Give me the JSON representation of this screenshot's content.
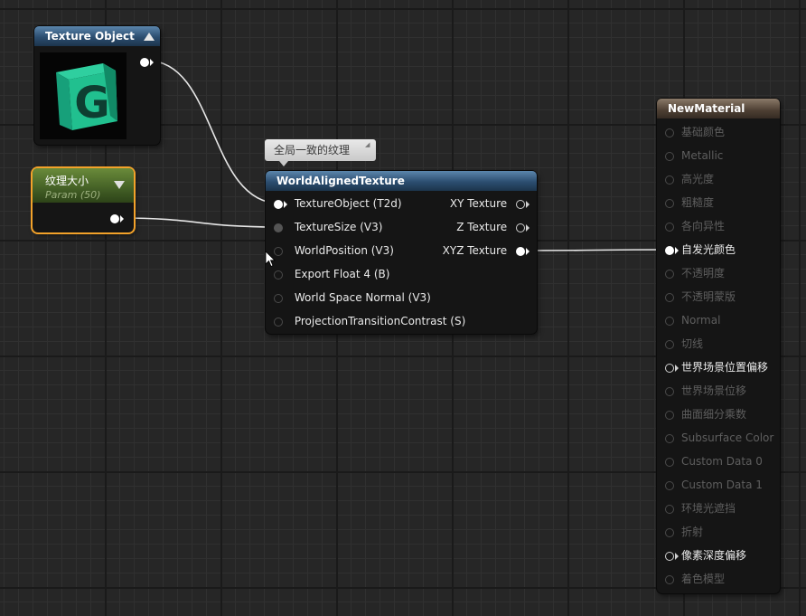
{
  "nodes": {
    "texture_object": {
      "title": "Texture Object",
      "thumbnail_glyph": "G"
    },
    "texture_size_param": {
      "title": "纹理大小",
      "subtitle": "Param (50)"
    },
    "comment": {
      "text": "全局一致的纹理"
    },
    "world_aligned_texture": {
      "title": "WorldAlignedTexture",
      "inputs": [
        {
          "label": "TextureObject (T2d)"
        },
        {
          "label": "TextureSize (V3)"
        },
        {
          "label": "WorldPosition (V3)"
        },
        {
          "label": "Export Float 4 (B)"
        },
        {
          "label": "World Space Normal (V3)"
        },
        {
          "label": "ProjectionTransitionContrast (S)"
        }
      ],
      "outputs": [
        {
          "label": "XY Texture"
        },
        {
          "label": "Z Texture"
        },
        {
          "label": "XYZ Texture"
        }
      ]
    },
    "new_material": {
      "title": "NewMaterial",
      "inputs": [
        {
          "label": "基础颜色"
        },
        {
          "label": "Metallic"
        },
        {
          "label": "高光度"
        },
        {
          "label": "粗糙度"
        },
        {
          "label": "各向异性"
        },
        {
          "label": "自发光颜色"
        },
        {
          "label": "不透明度"
        },
        {
          "label": "不透明蒙版"
        },
        {
          "label": "Normal"
        },
        {
          "label": "切线"
        },
        {
          "label": "世界场景位置偏移"
        },
        {
          "label": "世界场景位移"
        },
        {
          "label": "曲面细分乘数"
        },
        {
          "label": "Subsurface Color"
        },
        {
          "label": "Custom Data 0"
        },
        {
          "label": "Custom Data 1"
        },
        {
          "label": "环境光遮挡"
        },
        {
          "label": "折射"
        },
        {
          "label": "像素深度偏移"
        },
        {
          "label": "着色模型"
        }
      ]
    }
  },
  "colors": {
    "canvas": "#262626",
    "selection_outline": "#f3a22a",
    "wire": "#e8e8e8"
  }
}
